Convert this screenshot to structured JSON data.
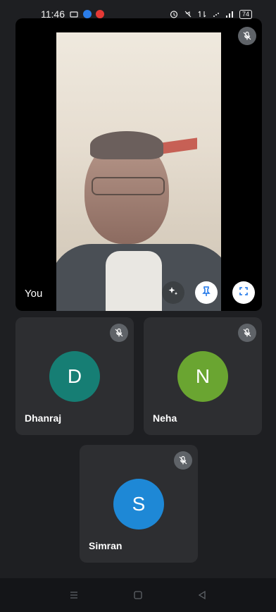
{
  "status_bar": {
    "time": "11:46",
    "battery": "74"
  },
  "self_view": {
    "label": "You"
  },
  "participants": [
    {
      "name": "Dhanraj",
      "initial": "D",
      "color": "#167e74"
    },
    {
      "name": "Neha",
      "initial": "N",
      "color": "#6aa531"
    },
    {
      "name": "Simran",
      "initial": "S",
      "color": "#1e88d6"
    }
  ],
  "icons": {
    "mic_off": "mic-off-icon",
    "effects": "sparkle-icon",
    "pin": "pin-icon",
    "fullscreen": "fullscreen-icon",
    "nav_menu": "menu-icon",
    "nav_home": "home-icon",
    "nav_back": "back-icon"
  },
  "colors": {
    "background": "#1e1f22",
    "tile": "#2d2e31",
    "mute_badge": "#5f6368",
    "pin_icon": "#1a73e8"
  }
}
